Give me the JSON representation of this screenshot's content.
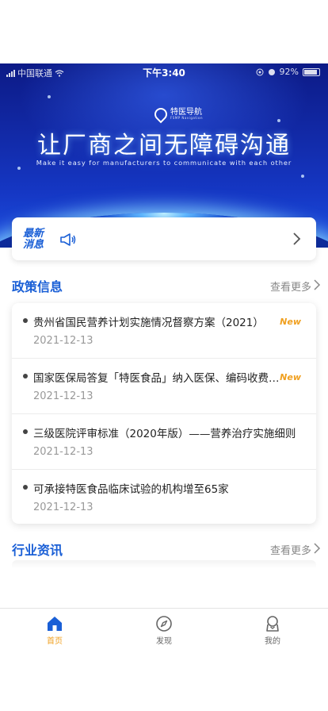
{
  "status_bar": {
    "carrier": "中国联通",
    "time": "下午3:40",
    "battery": "92%"
  },
  "banner": {
    "brand_name": "特医导航",
    "brand_sub": "FSMP Navigation",
    "headline": "让厂商之间无障碍沟通",
    "tagline": "Make it easy for manufacturers to communicate with each other"
  },
  "notice": {
    "label": "最新消息",
    "icons": [
      "megaphone-icon",
      "chevron-right-icon"
    ]
  },
  "policy": {
    "title": "政策信息",
    "more": "查看更多",
    "items": [
      {
        "title": "贵州省国民营养计划实施情况督察方案（2021）",
        "date": "2021-12-13",
        "badge": "New"
      },
      {
        "title": "国家医保局答复「特医食品」纳入医保、编码收费等问题",
        "date": "2021-12-13",
        "badge": "New"
      },
      {
        "title": "三级医院评审标准（2020年版）——营养治疗实施细则",
        "date": "2021-12-13",
        "badge": ""
      },
      {
        "title": "可承接特医食品临床试验的机构增至65家",
        "date": "2021-12-13",
        "badge": ""
      }
    ]
  },
  "industry": {
    "title": "行业资讯",
    "more": "查看更多"
  },
  "tabbar": {
    "items": [
      {
        "label": "首页",
        "icon": "home-icon",
        "active": true
      },
      {
        "label": "发现",
        "icon": "compass-icon",
        "active": false
      },
      {
        "label": "我的",
        "icon": "profile-icon",
        "active": false
      }
    ]
  },
  "colors": {
    "accent": "#1a5fd6",
    "badge": "#f0a020",
    "active_tab": "#f0a020"
  }
}
